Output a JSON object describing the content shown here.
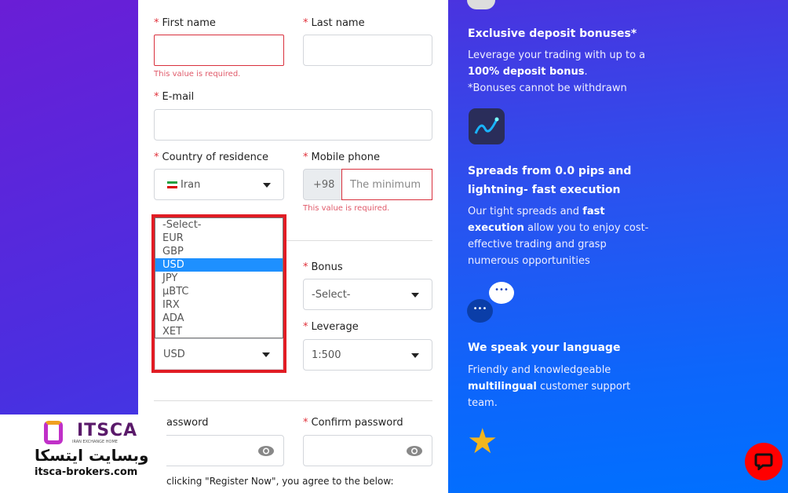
{
  "form": {
    "first_name_label": "First name",
    "last_name_label": "Last name",
    "required_error": "This value is required.",
    "email_label": "E-mail",
    "country_label": "Country of residence",
    "country_value": "Iran",
    "mobile_label": "Mobile phone",
    "phone_code": "+98",
    "phone_placeholder": "The minimum",
    "currency_options": [
      "-Select-",
      "EUR",
      "GBP",
      "USD",
      "JPY",
      "µBTC",
      "IRX",
      "ADA",
      "XET"
    ],
    "currency_selected": "USD",
    "bonus_label": "Bonus",
    "bonus_value": "-Select-",
    "leverage_label": "Leverage",
    "leverage_value": "1:500",
    "password_label": "assword",
    "confirm_password_label": "Confirm password",
    "agree_text": "clicking \"Register Now\", you agree to the below:"
  },
  "features": [
    {
      "title": "Exclusive deposit bonuses*",
      "line1": "Leverage your trading with up to a",
      "bold1": "100% deposit bonus",
      "tail1": ".",
      "line2": "*Bonuses cannot be withdrawn"
    },
    {
      "title1": "Spreads from 0.0 pips and",
      "title2": "lightning- fast execution",
      "t1": "Our tight spreads and ",
      "b1": "fast",
      "b2": "execution",
      "t2": " allow you to enjoy cost-",
      "t3": "effective trading and grasp",
      "t4": "numerous opportunities"
    },
    {
      "title": "We speak your language",
      "t1": "Friendly and knowledgeable",
      "b1": "multilingual",
      "t2": " customer support",
      "t3": "team."
    }
  ],
  "watermark": {
    "brand": "ITSCA",
    "tagline": "IRAN EXCHANGE HOME",
    "persian": "وبسایت ایتسکا",
    "site": "itsca-brokers.com"
  },
  "colors": {
    "accent": "#1e90ff",
    "error": "#d9303d",
    "highlight": "#e11c24",
    "chat": "#ff0000"
  }
}
